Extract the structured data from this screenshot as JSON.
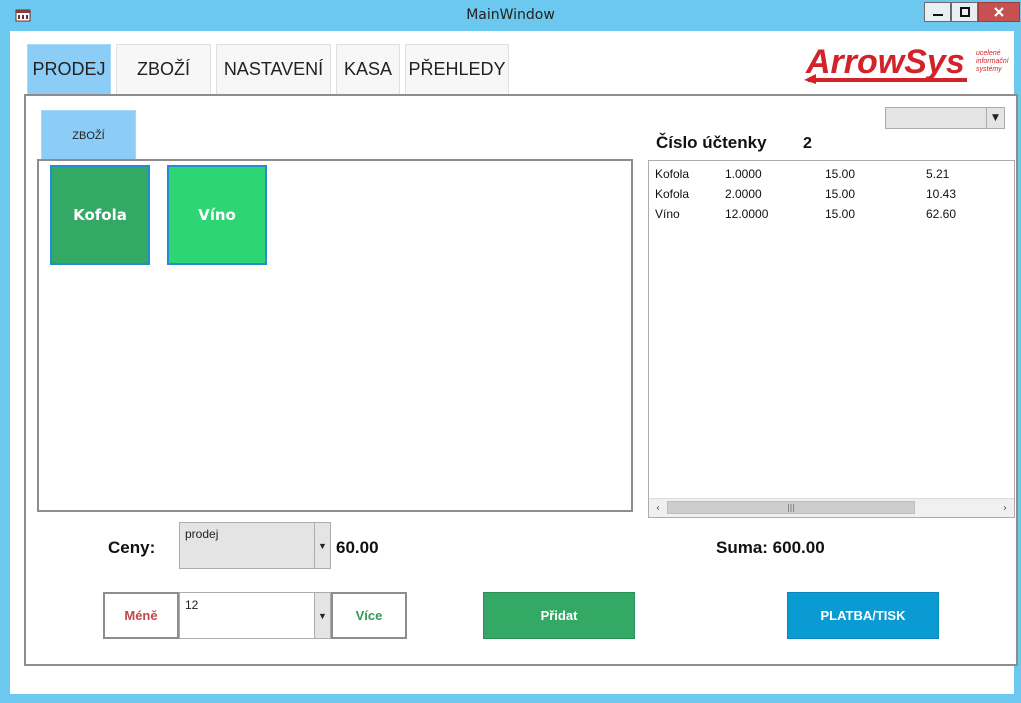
{
  "window": {
    "title": "MainWindow"
  },
  "tabs": [
    {
      "label": "PRODEJ"
    },
    {
      "label": "ZBOŽÍ"
    },
    {
      "label": "NASTAVENÍ"
    },
    {
      "label": "KASA"
    },
    {
      "label": "PŘEHLEDY"
    }
  ],
  "logo": {
    "name": "ArrowSys",
    "tagline": [
      "ucelené",
      "informační",
      "systémy"
    ]
  },
  "subtab": {
    "label": "ZBOŽÍ"
  },
  "products": [
    {
      "name": "Kofola",
      "color": "#34a865"
    },
    {
      "name": "Víno",
      "color": "#2ed673"
    }
  ],
  "receipt": {
    "title_label": "Číslo účtenky",
    "number": "2",
    "items": [
      {
        "name": "Kofola",
        "qty": "1.0000",
        "vat": "15.00",
        "price": "5.21"
      },
      {
        "name": "Kofola",
        "qty": "2.0000",
        "vat": "15.00",
        "price": "10.43"
      },
      {
        "name": "Víno",
        "qty": "12.0000",
        "vat": "15.00",
        "price": "62.60"
      }
    ]
  },
  "prices": {
    "label": "Ceny:",
    "selected": "prodej",
    "value": "60.00"
  },
  "sum": {
    "label": "Suma: 600.00"
  },
  "quantity": {
    "value": "12"
  },
  "buttons": {
    "less": "Méně",
    "more": "Více",
    "add": "Přidat",
    "pay": "PLATBA/TISK"
  },
  "colors": {
    "accent_blue": "#8bcdf7",
    "titlebar": "#6cc8ee",
    "add_green": "#34a865",
    "pay_blue": "#0b9bd3",
    "less_red": "#c0484c",
    "more_green": "#2f9a56",
    "logo_red": "#d3232a"
  }
}
